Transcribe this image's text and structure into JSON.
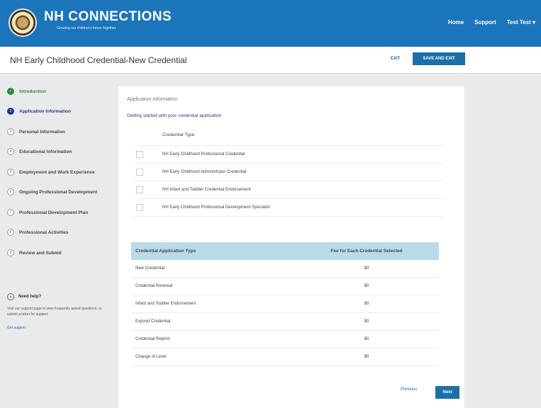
{
  "header": {
    "brand": "NH CONNECTIONS",
    "tagline": "Growing our children's future together",
    "nav": {
      "home": "Home",
      "support": "Support",
      "user": "Test Test ▾"
    }
  },
  "subheader": {
    "title": "NH Early Childhood Credential-New Credential",
    "exit_label": "EXIT",
    "save_exit_label": "SAVE AND EXIT"
  },
  "sidebar": {
    "steps": [
      {
        "num": "✓",
        "label": "Introduction",
        "state": "done"
      },
      {
        "num": "2",
        "label": "Application Information",
        "state": "active"
      },
      {
        "num": "3",
        "label": "Personal Information",
        "state": "todo"
      },
      {
        "num": "4",
        "label": "Educational Information",
        "state": "todo"
      },
      {
        "num": "5",
        "label": "Employment and Work Experience",
        "state": "todo"
      },
      {
        "num": "6",
        "label": "Ongoing Professional Development",
        "state": "todo"
      },
      {
        "num": "7",
        "label": "Professional Development Plan",
        "state": "todo"
      },
      {
        "num": "8",
        "label": "Professional Activities",
        "state": "todo"
      },
      {
        "num": "9",
        "label": "Review and Submit",
        "state": "todo"
      }
    ],
    "help": {
      "title": "Need help?",
      "text": "Visit our support page to view frequently asked questions, or submit a ticket for support.",
      "link": "Get support"
    }
  },
  "main": {
    "section_title": "Application Information",
    "intro": "Getting started with your credential application",
    "credential_header": "Credential Type",
    "credentials": [
      "NH Early Childhood Professional Credential",
      "NH Early Childhood Administrator Credential",
      "NH Infant and Toddler Credential Endorsement",
      "NH Early Childhood Professional Development Specialist"
    ],
    "fee_table": {
      "headers": [
        "Credential Application Type",
        "Fee for Each Credential Selected"
      ],
      "rows": [
        [
          "New Credential",
          "$0"
        ],
        [
          "Credential Renewal",
          "$0"
        ],
        [
          "Infant and Toddler Endorsement",
          "$0"
        ],
        [
          "Expired Credential",
          "$0"
        ],
        [
          "Credential Reprint",
          "$0"
        ],
        [
          "Change of Level",
          "$0"
        ]
      ]
    },
    "previous_label": "Previous",
    "next_label": "Next"
  }
}
